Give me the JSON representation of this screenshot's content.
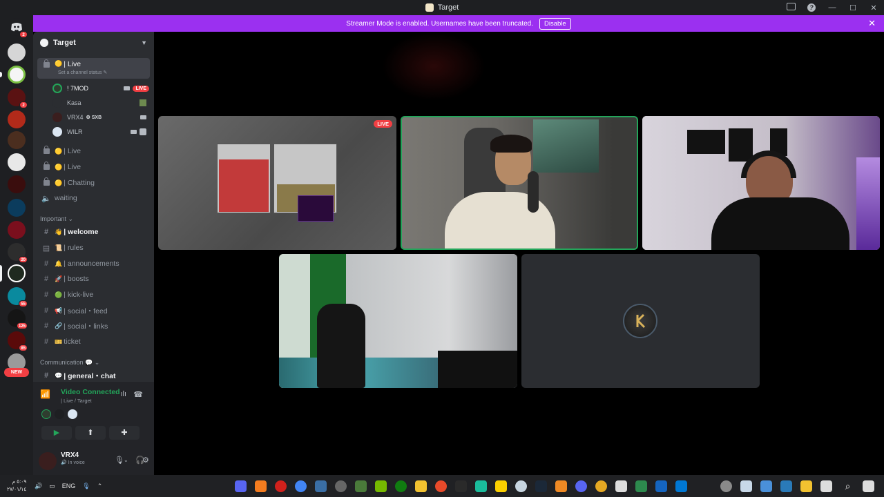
{
  "window": {
    "title": "Target"
  },
  "banner": {
    "message": "Streamer Mode is enabled. Usernames have been truncated.",
    "disable_label": "Disable"
  },
  "guild": {
    "name": "Target"
  },
  "active_channel": {
    "name": "| Live",
    "status_placeholder": "Set a channel status"
  },
  "voice_users": [
    {
      "name": "! 7MOD",
      "live": "LIVE"
    },
    {
      "name": "Kasa"
    },
    {
      "name": "VRX4",
      "tag": "SXB"
    },
    {
      "name": "WILR"
    }
  ],
  "voice_channels": [
    "| Live",
    "| Live",
    "| Chatting",
    "waiting"
  ],
  "categories": {
    "important": "Important",
    "communication": "Communication"
  },
  "text_channels": [
    {
      "name": "| welcome",
      "emoji": "👋"
    },
    {
      "name": "| rules",
      "emoji": "📜"
    },
    {
      "name": "| announcements",
      "emoji": "🔔"
    },
    {
      "name": "| boosts",
      "emoji": "🚀"
    },
    {
      "name": "| kick-live",
      "emoji": "🟢"
    },
    {
      "name": "| social・feed",
      "emoji": "📢"
    },
    {
      "name": "| social・links",
      "emoji": "🔗"
    },
    {
      "name": "ticket",
      "emoji": "🎫"
    },
    {
      "name": "| general・chat",
      "emoji": "💬"
    }
  ],
  "voice_panel": {
    "status": "Video Connected",
    "location": "| Live / Target"
  },
  "user": {
    "name": "VRX4",
    "status": "In voice"
  },
  "rail_badges": [
    "2",
    "2",
    "20",
    "55",
    "125",
    "85"
  ],
  "new_label": "NEW",
  "tiles": {
    "live_label": "LIVE"
  },
  "taskbar": {
    "time": "٥:٠٩ م",
    "date": "٢٧/٠١/١٤",
    "lang": "ENG"
  },
  "colors": {
    "accent": "#9b30f0",
    "live": "#f23f43",
    "connected": "#23a55a"
  }
}
